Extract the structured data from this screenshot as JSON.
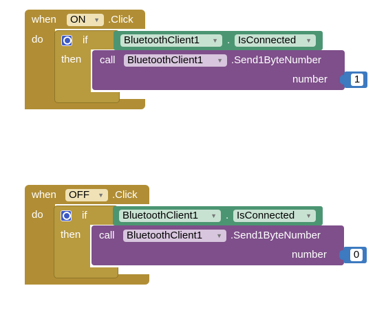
{
  "blocks": [
    {
      "when_label": "when",
      "component": "ON",
      "event": ".Click",
      "do_label": "do",
      "if_label": "if",
      "then_label": "then",
      "cond_component": "BluetoothClient1",
      "cond_dot": ".",
      "cond_property": "IsConnected",
      "call_label": "call",
      "call_component": "BluetoothClient1",
      "call_method": ".Send1ByteNumber",
      "param_label": "number",
      "param_value": "1"
    },
    {
      "when_label": "when",
      "component": "OFF",
      "event": ".Click",
      "do_label": "do",
      "if_label": "if",
      "then_label": "then",
      "cond_component": "BluetoothClient1",
      "cond_dot": ".",
      "cond_property": "IsConnected",
      "call_label": "call",
      "call_component": "BluetoothClient1",
      "call_method": ".Send1ByteNumber",
      "param_label": "number",
      "param_value": "0"
    }
  ],
  "colors": {
    "event_block": "#b18e35",
    "control_block": "#b89a3f",
    "getter_block": "#4c9572",
    "call_block": "#7e4f8a",
    "number_block": "#3d7ac0"
  }
}
